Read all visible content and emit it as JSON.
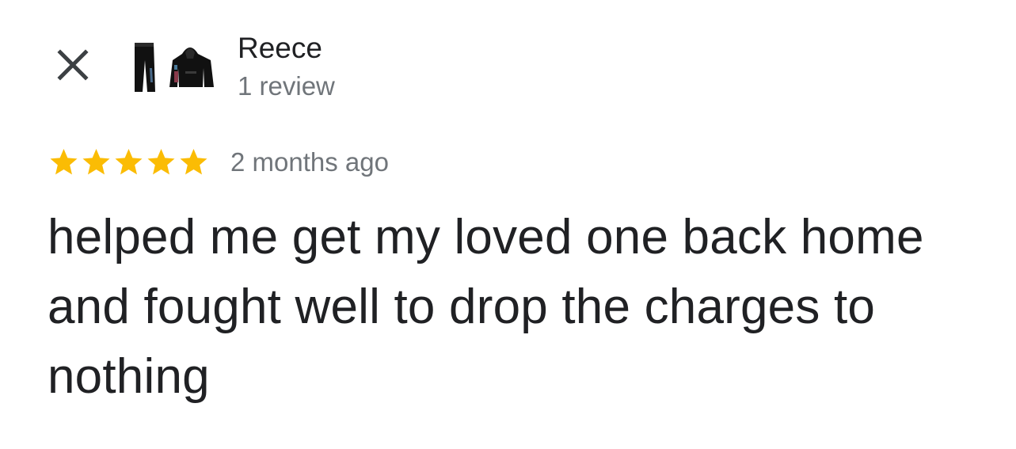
{
  "reviewer": {
    "name": "Reece",
    "meta": "1 review",
    "avatar_icon": "clothing-avatar-icon"
  },
  "controls": {
    "close_icon": "close-icon"
  },
  "rating": {
    "stars": 5,
    "max_stars": 5,
    "star_color": "#fbbc04",
    "date": "2 months ago"
  },
  "review": {
    "text": "helped me get my loved one back home and fought well to drop the charges to nothing"
  }
}
